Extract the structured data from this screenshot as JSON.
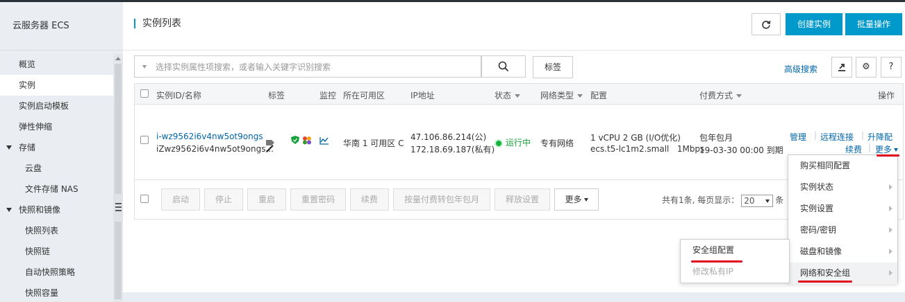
{
  "sidebar": {
    "title": "云服务器 ECS",
    "items": [
      {
        "label": "概览"
      },
      {
        "label": "实例"
      },
      {
        "label": "实例启动模板"
      },
      {
        "label": "弹性伸缩"
      },
      {
        "label": "存储"
      },
      {
        "label": "云盘"
      },
      {
        "label": "文件存储 NAS"
      },
      {
        "label": "快照和镜像"
      },
      {
        "label": "快照列表"
      },
      {
        "label": "快照链"
      },
      {
        "label": "自动快照策略"
      },
      {
        "label": "快照容量"
      }
    ]
  },
  "header": {
    "title": "实例列表",
    "create_label": "创建实例",
    "batch_label": "批量操作"
  },
  "search": {
    "placeholder": "选择实例属性项搜索，或者输入关键字识别搜索",
    "tag_label": "标签",
    "advanced_label": "高级搜索"
  },
  "table": {
    "columns": [
      "实例ID/名称",
      "标签",
      "监控",
      "所在可用区",
      "IP地址",
      "状态",
      "网络类型",
      "配置",
      "付费方式",
      "操作"
    ],
    "row": {
      "id": "i-wz9562i6v4nw5ot9ongs",
      "name": "iZwz9562i6v4nw5ot9ongs...",
      "zone": "华南 1 可用区 C",
      "ip_public": "47.106.86.214(公)",
      "ip_private": "172.18.69.187(私有)",
      "status": "运行中",
      "network": "专有网络",
      "config_line1": "1 vCPU 2 GB (I/O优化)",
      "config_line2": "ecs.t5-lc1m2.small   1Mbps",
      "pay_line1": "包年包月",
      "pay_line2": "19-03-30 00:00 到期",
      "actions": [
        "管理",
        "远程连接",
        "升降配",
        "续费",
        "更多"
      ]
    },
    "footer_buttons": [
      "启动",
      "停止",
      "重启",
      "重置密码",
      "续费",
      "按量付费转包年包月",
      "释放设置",
      "更多"
    ],
    "pagination": {
      "total_text": "共有1条, 每页显示：",
      "page_size": "20",
      "suffix": "条"
    }
  },
  "more_menu": {
    "items": [
      "购买相同配置",
      "实例状态",
      "实例设置",
      "密码/密钥",
      "磁盘和镜像",
      "网络和安全组"
    ]
  },
  "sub_menu": {
    "items": [
      "安全组配置",
      "修改私有IP"
    ]
  },
  "colors": {
    "primary": "#0099cc",
    "link": "#0066aa",
    "running": "#17a13a",
    "highlight": "#e0001b"
  }
}
